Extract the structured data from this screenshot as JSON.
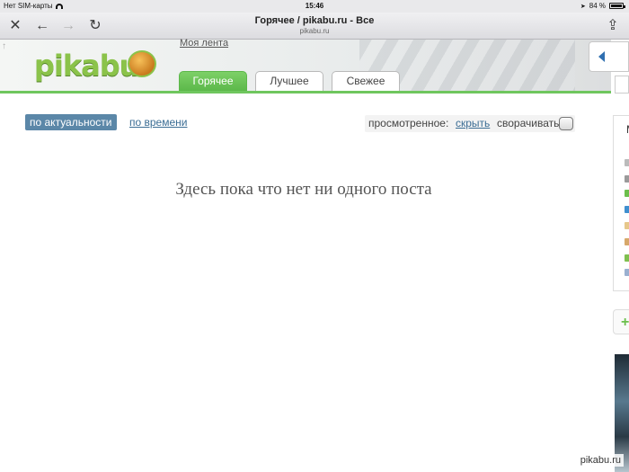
{
  "statusbar": {
    "carrier": "Нет SIM-карты",
    "time": "15:46",
    "battery": "84 %",
    "battery_level": 0.84
  },
  "browser": {
    "page_title": "Горячее / pikabu.ru - Все",
    "url": "pikabu.ru"
  },
  "header": {
    "logo_text": "pikabu",
    "my_feed": "Моя лента",
    "tabs": [
      {
        "label": "Горячее",
        "active": true
      },
      {
        "label": "Лучшее",
        "active": false
      },
      {
        "label": "Свежее",
        "active": false
      }
    ]
  },
  "sort": {
    "active": "по актуальности",
    "other": "по времени"
  },
  "viewed": {
    "label": "просмотренное:",
    "hide": "скрыть",
    "collapse": "сворачивать"
  },
  "empty_message": "Здесь пока что нет ни одного поста",
  "sidebar": {
    "letter": "М"
  },
  "watermark": "pikabu.ru",
  "colors": {
    "accent_green": "#6fc65e",
    "link_blue": "#3b6d94",
    "sort_active_bg": "#5b87a8"
  }
}
